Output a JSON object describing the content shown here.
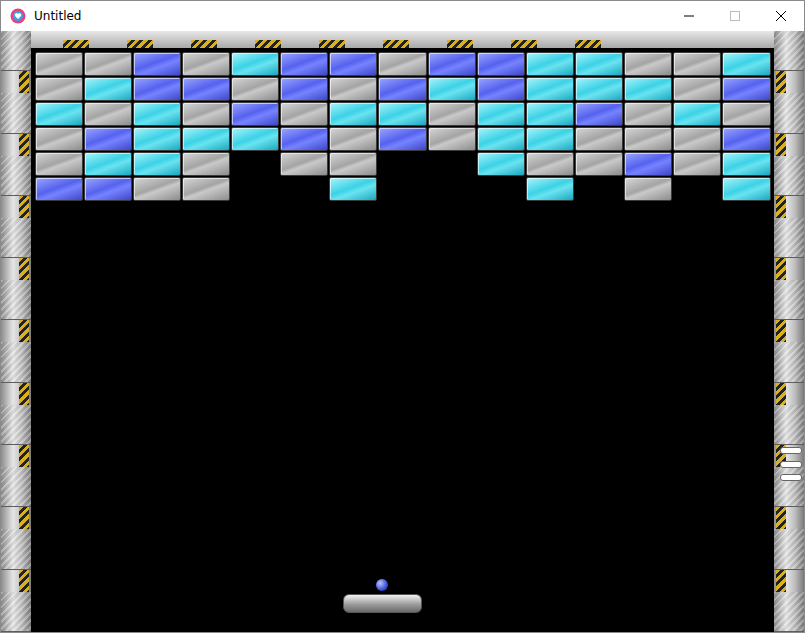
{
  "window": {
    "title": "Untitled"
  },
  "bricks": [
    [
      {
        "kind": "metal"
      },
      {
        "kind": "metal"
      },
      {
        "kind": "blue"
      },
      {
        "kind": "metal"
      },
      {
        "kind": "cyan"
      },
      {
        "kind": "blue"
      },
      {
        "kind": "blue"
      },
      {
        "kind": "metal"
      },
      {
        "kind": "blue"
      },
      {
        "kind": "blue"
      },
      {
        "kind": "cyan"
      },
      {
        "kind": "cyan"
      },
      {
        "kind": "metal"
      },
      {
        "kind": "metal"
      },
      {
        "kind": "cyan"
      }
    ],
    [
      {
        "kind": "metal"
      },
      {
        "kind": "cyan"
      },
      {
        "kind": "blue"
      },
      {
        "kind": "blue"
      },
      {
        "kind": "metal"
      },
      {
        "kind": "blue"
      },
      {
        "kind": "metal"
      },
      {
        "kind": "blue"
      },
      {
        "kind": "cyan"
      },
      {
        "kind": "blue"
      },
      {
        "kind": "cyan"
      },
      {
        "kind": "cyan"
      },
      {
        "kind": "cyan"
      },
      {
        "kind": "metal"
      },
      {
        "kind": "blue"
      }
    ],
    [
      {
        "kind": "cyan"
      },
      {
        "kind": "metal"
      },
      {
        "kind": "cyan"
      },
      {
        "kind": "metal"
      },
      {
        "kind": "blue"
      },
      {
        "kind": "metal"
      },
      {
        "kind": "cyan"
      },
      {
        "kind": "cyan"
      },
      {
        "kind": "metal"
      },
      {
        "kind": "cyan"
      },
      {
        "kind": "cyan"
      },
      {
        "kind": "blue"
      },
      {
        "kind": "metal"
      },
      {
        "kind": "cyan"
      },
      {
        "kind": "metal"
      }
    ],
    [
      {
        "kind": "metal"
      },
      {
        "kind": "blue"
      },
      {
        "kind": "cyan"
      },
      {
        "kind": "cyan"
      },
      {
        "kind": "cyan"
      },
      {
        "kind": "blue"
      },
      {
        "kind": "metal"
      },
      {
        "kind": "blue"
      },
      {
        "kind": "metal"
      },
      {
        "kind": "cyan"
      },
      {
        "kind": "cyan"
      },
      {
        "kind": "metal"
      },
      {
        "kind": "metal"
      },
      {
        "kind": "metal"
      },
      {
        "kind": "blue"
      }
    ],
    [
      {
        "kind": "metal"
      },
      {
        "kind": "cyan"
      },
      {
        "kind": "cyan"
      },
      {
        "kind": "metal"
      },
      {
        "kind": "empty"
      },
      {
        "kind": "metal"
      },
      {
        "kind": "metal"
      },
      {
        "kind": "empty"
      },
      {
        "kind": "empty"
      },
      {
        "kind": "cyan"
      },
      {
        "kind": "metal"
      },
      {
        "kind": "metal"
      },
      {
        "kind": "blue"
      },
      {
        "kind": "metal"
      },
      {
        "kind": "cyan"
      }
    ],
    [
      {
        "kind": "blue"
      },
      {
        "kind": "blue"
      },
      {
        "kind": "metal"
      },
      {
        "kind": "metal"
      },
      {
        "kind": "empty"
      },
      {
        "kind": "empty"
      },
      {
        "kind": "cyan"
      },
      {
        "kind": "empty"
      },
      {
        "kind": "empty"
      },
      {
        "kind": "empty"
      },
      {
        "kind": "cyan"
      },
      {
        "kind": "empty"
      },
      {
        "kind": "metal"
      },
      {
        "kind": "empty"
      },
      {
        "kind": "cyan"
      }
    ]
  ]
}
